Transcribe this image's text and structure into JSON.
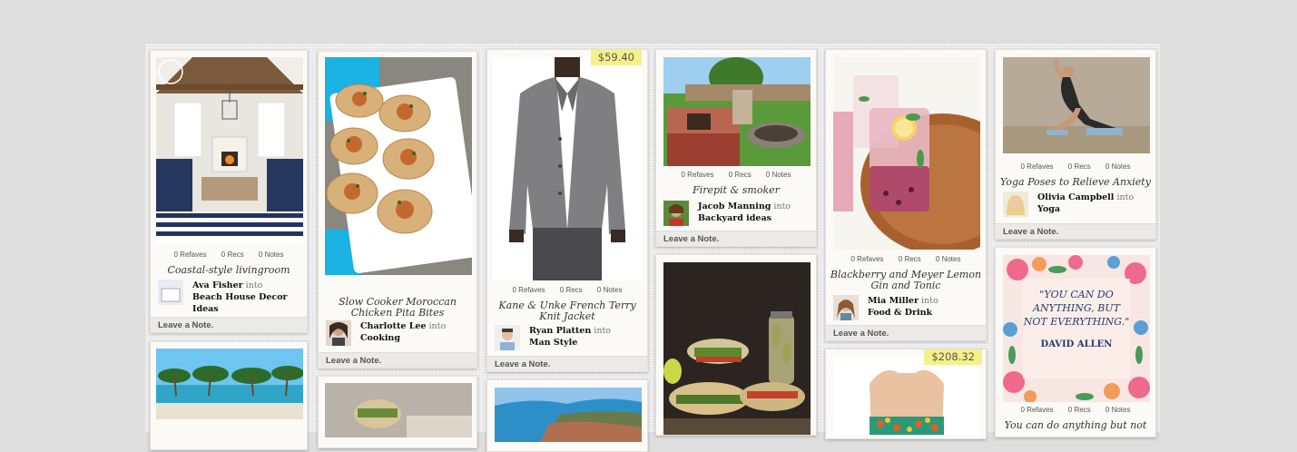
{
  "cards": [
    {
      "title": "Coastal-style livingroom",
      "stats": {
        "refaves": "0 Refaves",
        "recs": "0 Recs",
        "notes": "0 Notes"
      },
      "user": "Ava Fisher",
      "into": "into",
      "board": "Beach House Decor Ideas",
      "note": "Leave a Note."
    },
    {
      "title": "Slow Cooker Moroccan Chicken Pita Bites",
      "user": "Charlotte Lee",
      "into": "into",
      "board": "Cooking",
      "note": "Leave a Note."
    },
    {
      "price": "$59.40",
      "title": "Kane & Unke French Terry Knit Jacket",
      "stats": {
        "refaves": "0 Refaves",
        "recs": "0 Recs",
        "notes": "0 Notes"
      },
      "user": "Ryan Platten",
      "into": "into",
      "board": "Man Style",
      "note": "Leave a Note."
    },
    {
      "title": "Firepit & smoker",
      "stats": {
        "refaves": "0 Refaves",
        "recs": "0 Recs",
        "notes": "0 Notes"
      },
      "user": "Jacob Manning",
      "into": "into",
      "board": "Backyard ideas",
      "note": "Leave a Note."
    },
    {
      "title": "Blackberry and Meyer Lemon Gin and Tonic",
      "stats": {
        "refaves": "0 Refaves",
        "recs": "0 Recs",
        "notes": "0 Notes"
      },
      "user": "Mia Miller",
      "into": "into",
      "board": "Food & Drink",
      "note": "Leave a Note."
    },
    {
      "title": "Yoga Poses to Relieve Anxiety",
      "stats": {
        "refaves": "0 Refaves",
        "recs": "0 Recs",
        "notes": "0 Notes"
      },
      "user": "Olivia Campbell",
      "into": "into",
      "board": "Yoga",
      "note": "Leave a Note."
    },
    {
      "price": "$208.32"
    },
    {
      "quote_lines": [
        "\"YOU CAN DO",
        "ANYTHING, BUT",
        "NOT EVERYTHING.\""
      ],
      "quote_author": "DAVID ALLEN",
      "stats": {
        "refaves": "0 Refaves",
        "recs": "0 Recs",
        "notes": "0 Notes"
      },
      "title": "You can do anything but not"
    }
  ],
  "colors": {
    "page_bg": "#dedede",
    "price_tag": "#f5f08a",
    "card_bg": "#fbfaf7"
  }
}
